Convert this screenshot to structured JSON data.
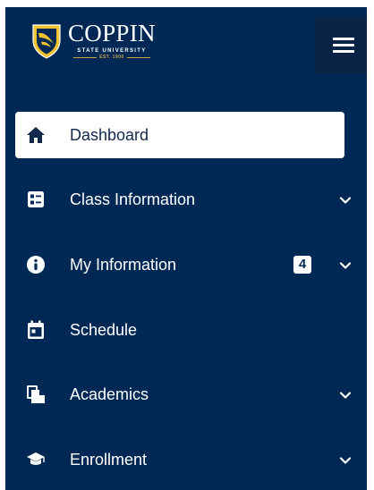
{
  "brand": {
    "name": "COPPIN",
    "subtitle": "STATE UNIVERSITY",
    "established": "EST. 1900",
    "colors": {
      "navy": "#002855",
      "gold": "#f2c12e",
      "toggle_bg": "#0b2346",
      "active_bg": "#ffffff"
    }
  },
  "header": {
    "menu_toggle_icon": "hamburger-menu-icon"
  },
  "nav": {
    "items": [
      {
        "label": "Dashboard",
        "icon": "home-icon",
        "active": true,
        "expandable": false
      },
      {
        "label": "Class Information",
        "icon": "class-list-icon",
        "active": false,
        "expandable": true
      },
      {
        "label": "My Information",
        "icon": "info-icon",
        "active": false,
        "expandable": true,
        "badge": "4"
      },
      {
        "label": "Schedule",
        "icon": "calendar-icon",
        "active": false,
        "expandable": false
      },
      {
        "label": "Academics",
        "icon": "documents-icon",
        "active": false,
        "expandable": true
      },
      {
        "label": "Enrollment",
        "icon": "graduation-cap-icon",
        "active": false,
        "expandable": true
      }
    ]
  }
}
